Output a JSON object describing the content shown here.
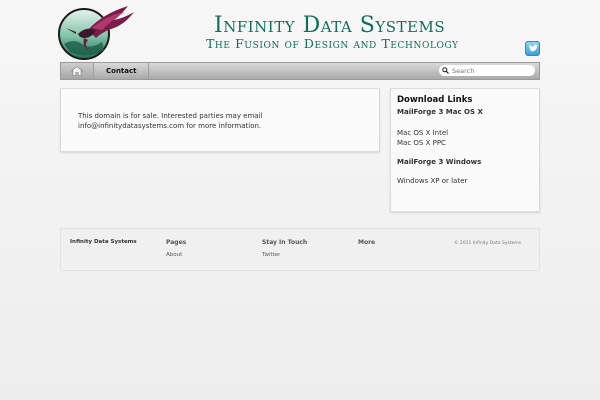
{
  "header": {
    "title": "Infinity Data Systems",
    "tagline": "The Fusion of Design and Technology",
    "logo_icon": "hummingbird-globe-logo",
    "social_icon": "twitter-icon"
  },
  "nav": {
    "home_icon": "home-icon",
    "items": [
      {
        "label": "Contact"
      }
    ],
    "search": {
      "placeholder": "Search",
      "icon": "search-icon"
    }
  },
  "main": {
    "notice": "This domain is for sale. Interested parties may email info@infinitydatasystems.com for more information."
  },
  "sidebar": {
    "heading": "Download Links",
    "groups": [
      {
        "title": "MailForge 3 Mac OS X",
        "items": [
          "Mac OS X Intel",
          "Mac OS X PPC"
        ]
      },
      {
        "title": "MailForge 3 Windows",
        "items": [
          "Windows XP or later"
        ]
      }
    ]
  },
  "footer": {
    "site_name": "Infinity Data Systems",
    "columns": [
      {
        "heading": "Pages",
        "links": [
          "About"
        ]
      },
      {
        "heading": "Stay In Touch",
        "links": [
          "Twitter"
        ]
      },
      {
        "heading": "More",
        "links": []
      }
    ],
    "copyright": "© 2011 Infinity Data Systems"
  },
  "colors": {
    "brand_green": "#0f6f5a",
    "nav_gradient_top": "#d9d9d9",
    "nav_gradient_bottom": "#a9a9a9",
    "twitter_blue": "#3a9fd8"
  }
}
